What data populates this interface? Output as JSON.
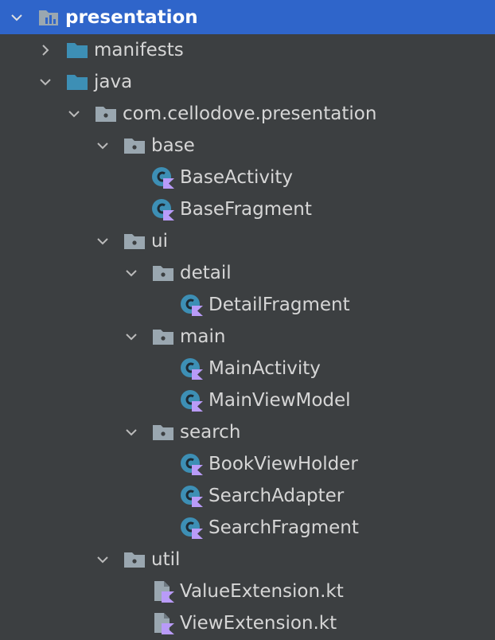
{
  "tree": {
    "root": {
      "label": "presentation",
      "icon": "module-icon",
      "expanded": true
    },
    "items": [
      {
        "label": "manifests",
        "icon": "folder-icon",
        "expanded": false
      },
      {
        "label": "java",
        "icon": "folder-icon",
        "expanded": true
      },
      {
        "label": "com.cellodove.presentation",
        "icon": "package-icon",
        "expanded": true
      },
      {
        "label": "base",
        "icon": "package-icon",
        "expanded": true
      },
      {
        "label": "BaseActivity",
        "icon": "kotlin-class-icon"
      },
      {
        "label": "BaseFragment",
        "icon": "kotlin-class-icon"
      },
      {
        "label": "ui",
        "icon": "package-icon",
        "expanded": true
      },
      {
        "label": "detail",
        "icon": "package-icon",
        "expanded": true
      },
      {
        "label": "DetailFragment",
        "icon": "kotlin-class-icon"
      },
      {
        "label": "main",
        "icon": "package-icon",
        "expanded": true
      },
      {
        "label": "MainActivity",
        "icon": "kotlin-class-icon"
      },
      {
        "label": "MainViewModel",
        "icon": "kotlin-class-icon"
      },
      {
        "label": "search",
        "icon": "package-icon",
        "expanded": true
      },
      {
        "label": "BookViewHolder",
        "icon": "kotlin-class-icon"
      },
      {
        "label": "SearchAdapter",
        "icon": "kotlin-class-icon"
      },
      {
        "label": "SearchFragment",
        "icon": "kotlin-class-icon"
      },
      {
        "label": "util",
        "icon": "package-icon",
        "expanded": true
      },
      {
        "label": "ValueExtension.kt",
        "icon": "kotlin-file-icon"
      },
      {
        "label": "ViewExtension.kt",
        "icon": "kotlin-file-icon"
      }
    ]
  },
  "colors": {
    "background": "#3c3f41",
    "selection": "#2f65ca",
    "folder": "#3d8fb5",
    "package": "#9aa7b0",
    "class_circle": "#3d8fb5",
    "kotlin": "#b99bf8"
  }
}
